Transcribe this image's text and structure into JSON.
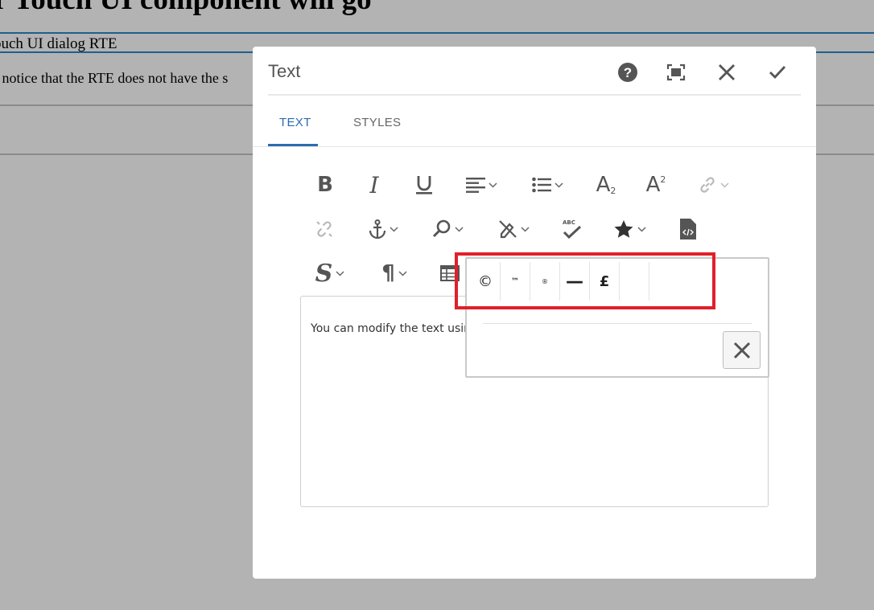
{
  "background": {
    "heading": "ur Touch UI component will go",
    "subtitle": "ouch UI dialog RTE",
    "text": "- notice that the RTE does not have the s",
    "line_color": "#1f5f8f"
  },
  "dialog": {
    "title": "Text",
    "header_icons": [
      "help-icon",
      "fullscreen-icon",
      "close-icon",
      "confirm-check-icon"
    ],
    "tabs": [
      {
        "label": "TEXT",
        "active": true
      },
      {
        "label": "STYLES",
        "active": false
      }
    ],
    "accent_color": "#2b6cb0"
  },
  "toolbar": {
    "row1": [
      "bold-icon",
      "italic-icon",
      "underline-icon",
      "justify-icon",
      "list-icon",
      "subscript-icon",
      "superscript-icon",
      "link-icon"
    ],
    "row2": [
      "unlink-icon",
      "anchor-icon",
      "find-icon",
      "remove-format-icon",
      "spellcheck-icon",
      "special-chars-icon",
      "source-edit-icon"
    ],
    "row3": [
      "styles-icon",
      "paragraph-format-icon",
      "table-icon"
    ],
    "subscript_glyph": "A",
    "subscript_small": "2",
    "superscript_glyph": "A",
    "superscript_small": "2",
    "spellcheck_label": "ABC"
  },
  "editor": {
    "content": "You can modify the text using"
  },
  "special_chars": {
    "chars": [
      "©",
      "™",
      "®",
      "—",
      "£",
      ""
    ],
    "highlight_color": "#e0202a"
  }
}
